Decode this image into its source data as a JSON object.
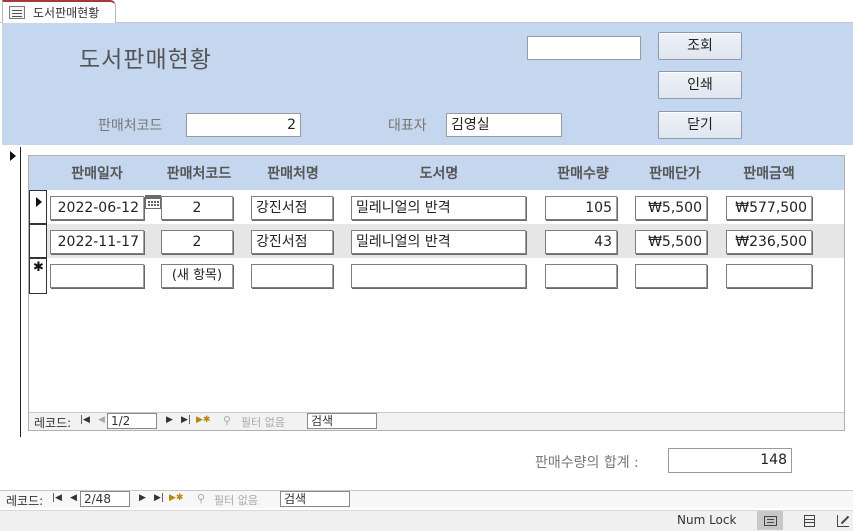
{
  "tab": {
    "title": "도서판매현황",
    "icon": "form-icon"
  },
  "form": {
    "title": "도서판매현황",
    "search_value": "",
    "buttons": {
      "query": "조회",
      "print": "인쇄",
      "close": "닫기"
    },
    "seller_code_label": "판매처코드",
    "seller_code_value": "2",
    "rep_label": "대표자",
    "rep_value": "김영실"
  },
  "subform": {
    "columns": [
      "판매일자",
      "판매처코드",
      "판매처명",
      "도서명",
      "판매수량",
      "판매단가",
      "판매금액"
    ],
    "rows": [
      {
        "date": "2022-06-12",
        "code": "2",
        "seller": "강진서점",
        "book": "밀레니얼의 반격",
        "qty": "105",
        "price": "₩5,500",
        "amount": "₩577,500"
      },
      {
        "date": "2022-11-17",
        "code": "2",
        "seller": "강진서점",
        "book": "밀레니얼의 반격",
        "qty": "43",
        "price": "₩5,500",
        "amount": "₩236,500"
      }
    ],
    "new_row_code": "(새 항목)",
    "nav": {
      "label": "레코드:",
      "position": "1/2",
      "filter": "필터 없음",
      "search": "검색"
    }
  },
  "footer": {
    "total_label": "판매수량의 합계 :",
    "total_value": "148"
  },
  "main_nav": {
    "label": "레코드:",
    "position": "2/48",
    "filter": "필터 없음",
    "search": "검색"
  },
  "status": {
    "numlock": "Num Lock"
  }
}
